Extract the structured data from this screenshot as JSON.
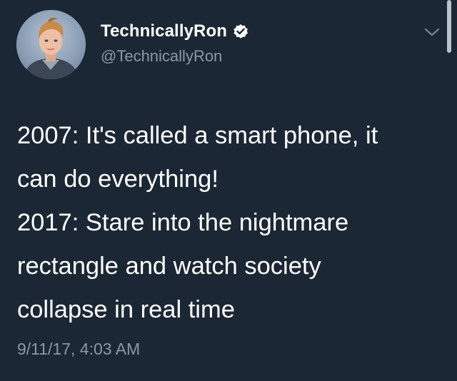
{
  "author": {
    "display_name": "TechnicallyRon",
    "handle": "@TechnicallyRon",
    "verified": true,
    "avatar_icon": "user-avatar"
  },
  "tweet": {
    "lines": [
      "2007: It's called a smart phone, it",
      "can do everything!",
      "2017: Stare into the nightmare",
      "rectangle and watch society",
      "collapse in real time"
    ],
    "timestamp": "9/11/17, 4:03 AM"
  },
  "icons": {
    "verified": "verified-badge-icon",
    "menu": "chevron-down-icon"
  },
  "colors": {
    "background": "#1b2734",
    "text": "#ffffff",
    "secondary_text": "#8899a6",
    "verified_badge": "#ffffff"
  }
}
